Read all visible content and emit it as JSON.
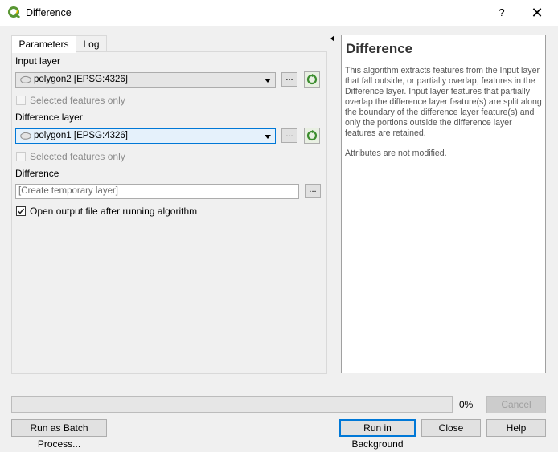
{
  "window": {
    "title": "Difference",
    "help": "?",
    "close": "✕"
  },
  "tabs": [
    {
      "label": "Parameters"
    },
    {
      "label": "Log"
    }
  ],
  "params": {
    "input_layer": {
      "label": "Input layer",
      "value": "polygon2 [EPSG:4326]",
      "dots": "...",
      "selected_only": "Selected features only"
    },
    "difference_layer": {
      "label": "Difference layer",
      "value": "polygon1 [EPSG:4326]",
      "dots": "...",
      "selected_only": "Selected features only"
    },
    "output": {
      "label": "Difference",
      "placeholder": "[Create temporary layer]",
      "dots": "...",
      "open_after": "Open output file after running algorithm",
      "open_after_checked": true
    }
  },
  "help": {
    "title": "Difference",
    "body": "This algorithm extracts features from the Input layer that fall outside, or partially overlap, features in the Difference layer. Input layer features that partially overlap the difference layer feature(s) are split along the boundary of the difference layer feature(s) and only the portions outside the difference layer features are retained.",
    "attributes": "Attributes are not modified."
  },
  "progress": {
    "value": 0,
    "label": "0%"
  },
  "buttons": {
    "cancel": "Cancel",
    "batch": "Run as Batch Process...",
    "background": "Run in Background",
    "close": "Close",
    "help": "Help"
  },
  "colors": {
    "accent": "#0078d7",
    "qgis_green": "#589632"
  }
}
